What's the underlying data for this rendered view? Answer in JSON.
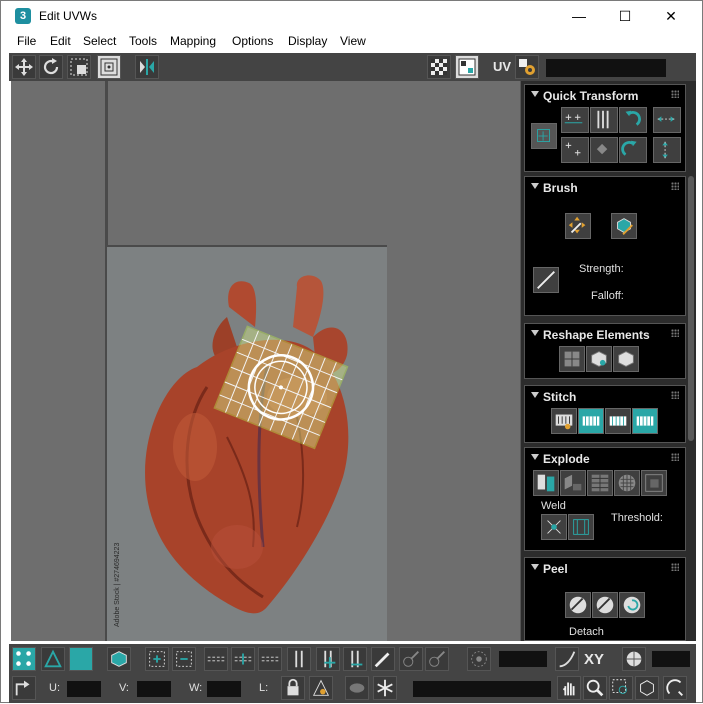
{
  "window": {
    "title": "Edit UVWs",
    "app_icon_text": "3",
    "minimize_symbol": "—",
    "maximize_symbol": "☐",
    "close_symbol": "✕"
  },
  "menu": [
    "File",
    "Edit",
    "Select",
    "Tools",
    "Mapping",
    "Options",
    "Display",
    "View"
  ],
  "toolbar_top": {
    "uv_label": "UV",
    "icons": [
      "move-icon",
      "rotate-icon",
      "scale-icon",
      "freeform-icon",
      "mirror-icon",
      "checker-icon",
      "texture-icon",
      "settings-icon"
    ]
  },
  "viewport": {
    "image": "heart-photo",
    "watermark": "Adobe Stock | #274694223"
  },
  "panel": {
    "quick_transform": {
      "title": "Quick Transform"
    },
    "brush": {
      "title": "Brush",
      "strength_label": "Strength:",
      "falloff_label": "Falloff:"
    },
    "reshape": {
      "title": "Reshape Elements"
    },
    "stitch": {
      "title": "Stitch"
    },
    "explode": {
      "title": "Explode",
      "weld_label": "Weld",
      "threshold_label": "Threshold:"
    },
    "peel": {
      "title": "Peel",
      "detach_label": "Detach"
    }
  },
  "toolbar_bottom": {
    "xy_label": "XY",
    "u_label": "U:",
    "v_label": "V:",
    "w_label": "W:",
    "l_label": "L:",
    "u_value": "",
    "v_value": "",
    "w_value": ""
  },
  "colors": {
    "accent": "#2aa7a7",
    "toolbar_bg": "#444444",
    "viewport_bg": "#6e6e6e",
    "uv_mesh": "#b8e04a"
  }
}
